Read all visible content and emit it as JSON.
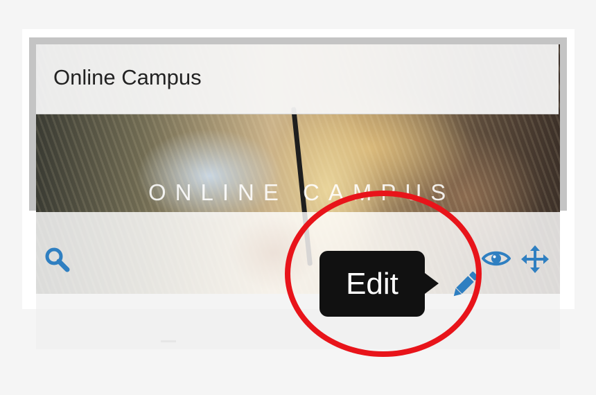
{
  "card": {
    "title": "Online Campus",
    "banner_text": "ONLINE CAMPUS"
  },
  "toolbar": {
    "search_icon": "search-icon",
    "eye_icon": "eye-icon",
    "move_icon": "move-icon",
    "edit_icon": "pencil-icon"
  },
  "tooltip": {
    "label": "Edit"
  },
  "colors": {
    "icon_blue": "#2f7fc1",
    "tooltip_bg": "#111111",
    "highlight_red": "#e8141a",
    "title_text": "#222222"
  }
}
